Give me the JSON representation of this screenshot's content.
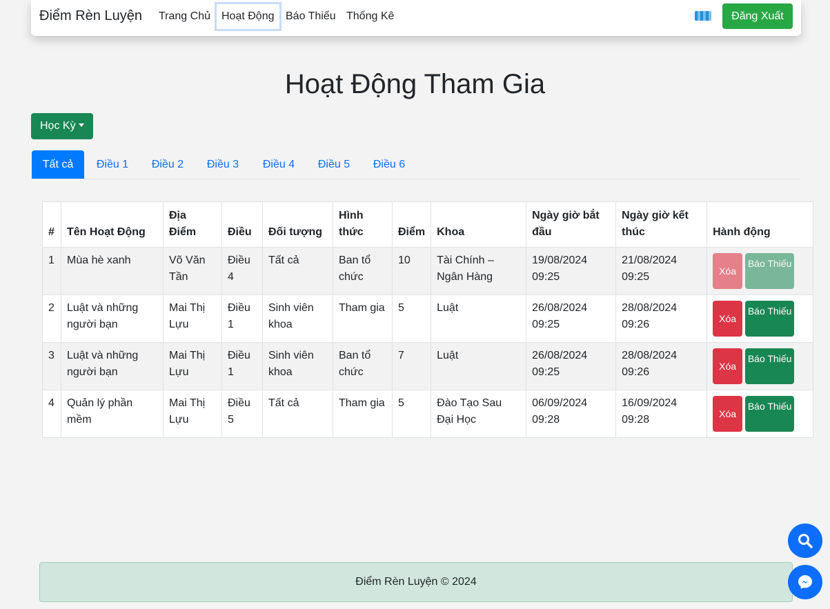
{
  "navbar": {
    "brand": "Điểm Rèn Luyện",
    "links": [
      "Trang Chủ",
      "Hoạt Động",
      "Báo Thiếu",
      "Thống Kê"
    ],
    "logout_label": "Đăng Xuất"
  },
  "page_title": "Hoạt Động Tham Gia",
  "semester_button": "Học Kỳ",
  "tabs": [
    "Tất cả",
    "Điều 1",
    "Điều 2",
    "Điều 3",
    "Điều 4",
    "Điều 5",
    "Điều 6"
  ],
  "table": {
    "headers": [
      "#",
      "Tên Hoạt Động",
      "Địa Điểm",
      "Điều",
      "Đối tượng",
      "Hình thức",
      "Điểm",
      "Khoa",
      "Ngày giờ bắt đầu",
      "Ngày giờ kết thúc",
      "Hành động"
    ],
    "rows": [
      [
        "1",
        "Mùa hè xanh",
        "Võ Văn Tần",
        "Điều 4",
        "Tất cả",
        "Ban tổ chức",
        "10",
        "Tài Chính – Ngân Hàng",
        "19/08/2024 09:25",
        "21/08/2024 09:25"
      ],
      [
        "2",
        "Luật và những người bạn",
        "Mai Thị Lựu",
        "Điều 1",
        "Sinh viên khoa",
        "Tham gia",
        "5",
        "Luật",
        "26/08/2024 09:25",
        "28/08/2024 09:26"
      ],
      [
        "3",
        "Luật và những người bạn",
        "Mai Thị Lựu",
        "Điều 1",
        "Sinh viên khoa",
        "Ban tổ chức",
        "7",
        "Luật",
        "26/08/2024 09:25",
        "28/08/2024 09:26"
      ],
      [
        "4",
        "Quản lý phần mềm",
        "Mai Thị Lựu",
        "Điều 5",
        "Tất cả",
        "Tham gia",
        "5",
        "Đào Tạo Sau Đại Học",
        "06/09/2024 09:28",
        "16/09/2024 09:28"
      ]
    ],
    "delete_label": "Xóa",
    "report_label": "Báo Thiếu"
  },
  "footer": "Điểm Rèn Luyện © 2024",
  "icons": {
    "search_fab": "search-icon",
    "messenger_fab": "messenger-icon",
    "flag": "flag-icon"
  },
  "colors": {
    "primary": "#0d6efd",
    "success": "#28a745",
    "danger": "#dc3545",
    "dark_green": "#198754"
  }
}
